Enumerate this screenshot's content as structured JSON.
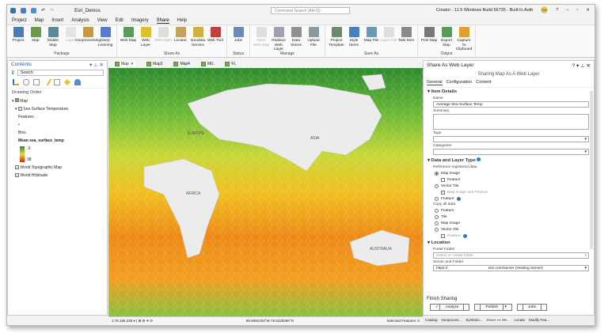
{
  "titlebar": {
    "project": "Esri_Demos",
    "command_search": "Command Search (Alt+Q)",
    "build": "Creator - 11.5 Windows Build 56735 - Built-In Auth",
    "user": "EA"
  },
  "menu": [
    "Project",
    "Map",
    "Insert",
    "Analysis",
    "View",
    "Edit",
    "Imagery",
    "Share",
    "Help"
  ],
  "ribbon": [
    {
      "group": "Package",
      "buttons": [
        "Project",
        "Map",
        "Mobile Map",
        "Layer",
        "Geoprocessing",
        "Deep Learning"
      ]
    },
    {
      "group": "Share As",
      "buttons": [
        "Web Map",
        "Web Layer",
        "Web Style",
        "Locator",
        "Geodata Service",
        "Web Tool"
      ]
    },
    {
      "group": "Status",
      "buttons": [
        "Jobs"
      ]
    },
    {
      "group": "Manage",
      "buttons": [
        "Save Web Map",
        "Replace Web Layer",
        "Data Stores",
        "Upload File"
      ]
    },
    {
      "group": "Save As",
      "buttons": [
        "Project Template",
        "Style Items",
        "Map File",
        "Layer File",
        "Task Item"
      ]
    },
    {
      "group": "Output",
      "buttons": [
        "Print Map",
        "Export Map",
        "Capture To Clipboard"
      ]
    }
  ],
  "contents": {
    "title": "Contents",
    "search_placeholder": "Search",
    "drawing_order": "Drawing Order",
    "map": "Map",
    "layer": "Sea Surface Temperature",
    "features": "Features",
    "bins": "Bins",
    "field": "Mean sea_surface_temp",
    "legend_min": "-3",
    "legend_max": "38",
    "basemaps": [
      "World Topographic Map",
      "World Hillshade"
    ]
  },
  "doc_tabs": [
    "Map",
    "Map3",
    "Map4",
    "MIL",
    "FL"
  ],
  "map": {
    "labels": [
      "EUROPE",
      "ASIA",
      "AFRICA",
      "AUSTRALIA"
    ],
    "colors": {
      "cold": "#2e8b2e",
      "mid": "#e8d830",
      "warm": "#e86a10"
    }
  },
  "status": {
    "scale": "1:78,196,348",
    "coords": "89.5992203°W 78.6228365°N",
    "selected": "Selected Features: 0"
  },
  "share": {
    "title": "Share As Web Layer",
    "subtitle": "Sharing Map As A Web Layer",
    "tabs": [
      "General",
      "Configuration",
      "Content"
    ],
    "item_details": "Item Details",
    "name_label": "Name",
    "name_value": "Average Sea Surface Temp",
    "summary_label": "Summary",
    "tags_label": "Tags",
    "categories_label": "Categories",
    "data_type": "Data and Layer Type",
    "ref_label": "Reference registered data",
    "ref_opts": [
      "Map Image",
      "Feature",
      "Vector Tile",
      "Map Image and Feature",
      "Feature"
    ],
    "copy_label": "Copy all data",
    "copy_opts": [
      "Feature",
      "Tile",
      "Map Image",
      "Vector Tile",
      "Feature"
    ],
    "location": "Location",
    "portal_folder": "Portal Folder",
    "portal_placeholder": "Select or create folder",
    "server_folder": "Server and Folder",
    "server_prefix": "https://",
    "server_value": ".esri.com/server (Hosting Server)",
    "finish": "Finish Sharing",
    "analyze": "Analyze",
    "publish": "Publish",
    "jobs": "Jobs"
  },
  "pane_tabs": [
    "Catalog",
    "Geoproces...",
    "Symbolo...",
    "Share As We...",
    "Locate",
    "Modify Fea..."
  ]
}
